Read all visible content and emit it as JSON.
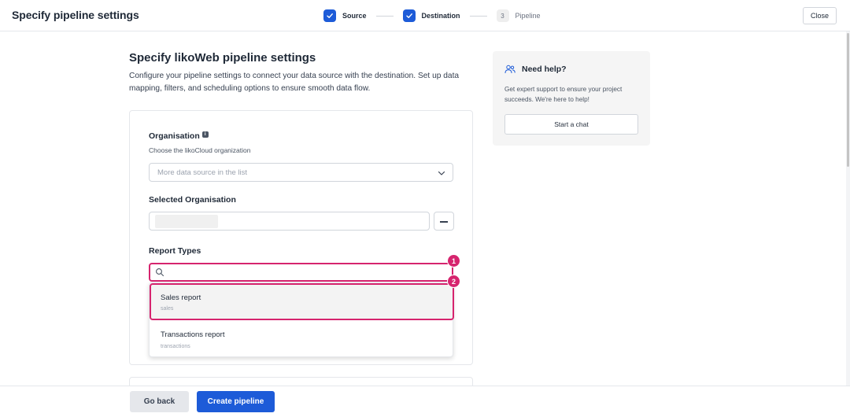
{
  "header": {
    "title": "Specify pipeline settings",
    "close_label": "Close",
    "steps": [
      {
        "label": "Source",
        "state": "done"
      },
      {
        "label": "Destination",
        "state": "done"
      },
      {
        "number": "3",
        "label": "Pipeline",
        "state": "pending"
      }
    ]
  },
  "main": {
    "title": "Specify likoWeb pipeline settings",
    "description": "Configure your pipeline settings to connect your data source with the destination. Set up data mapping, filters, and scheduling options to ensure smooth data flow."
  },
  "form": {
    "organisation_label": "Organisation",
    "organisation_hint": "Choose the likoCloud organization",
    "organisation_placeholder": "More data source in the list",
    "selected_org_label": "Selected Organisation",
    "report_types_label": "Report Types",
    "report_options": [
      {
        "title": "Sales report",
        "subtitle": "sales"
      },
      {
        "title": "Transactions report",
        "subtitle": "transactions"
      }
    ]
  },
  "annotations": {
    "badge_1": "1",
    "badge_2": "2"
  },
  "help": {
    "title": "Need help?",
    "text": "Get expert support to ensure your project succeeds. We're here to help!",
    "button_label": "Start a chat"
  },
  "footer": {
    "back_label": "Go back",
    "create_label": "Create pipeline"
  },
  "colors": {
    "primary": "#1d5bd8",
    "highlight": "#d6246e"
  }
}
